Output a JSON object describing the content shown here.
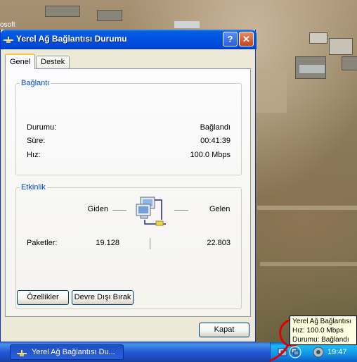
{
  "desktop": {
    "partial_text": "osoft"
  },
  "window": {
    "title": "Yerel Ağ Bağlantısı Durumu",
    "help_label": "?",
    "close_label": "✕",
    "tabs": [
      {
        "label": "Genel",
        "active": true
      },
      {
        "label": "Destek",
        "active": false
      }
    ],
    "connection": {
      "legend": "Bağlantı",
      "rows": [
        {
          "label": "Durumu:",
          "value": "Bağlandı"
        },
        {
          "label": "Süre:",
          "value": "00:41:39"
        },
        {
          "label": "Hız:",
          "value": "100.0 Mbps"
        }
      ]
    },
    "activity": {
      "legend": "Etkinlik",
      "sent_label": "Giden",
      "received_label": "Gelen",
      "packets_label": "Paketler:",
      "packets_sent": "19.128",
      "packets_received": "22.803"
    },
    "properties_button": "Özellikler",
    "disable_button": "Devre Dışı Bırak",
    "close_button": "Kapat"
  },
  "taskbar": {
    "task_label": "Yerel Ağ Bağlantısı Du...",
    "clock": "19:47"
  },
  "tooltip": {
    "lines": [
      "Yerel Ağ Bağlantısı",
      "Hız: 100.0 Mbps",
      "Durumu: Bağlandı"
    ]
  },
  "colors": {
    "titlebar": "#0054e3",
    "legend_text": "#0046d5",
    "window_bg": "#ece9d8",
    "taskbar": "#2157d7",
    "tooltip_bg": "#ffffe1"
  }
}
